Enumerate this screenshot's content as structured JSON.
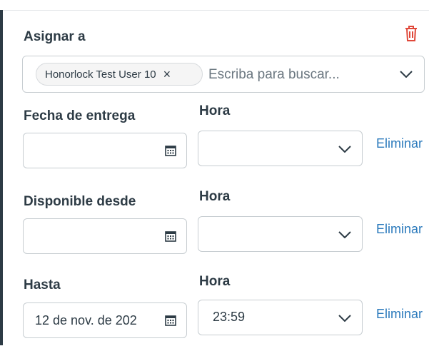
{
  "assign": {
    "label": "Asignar a",
    "chip_label": "Honorlock Test User 10",
    "chip_remove": "×",
    "search_placeholder": "Escriba para buscar..."
  },
  "rows": [
    {
      "date_label": "Fecha de entrega",
      "time_label": "Hora",
      "date_value": "",
      "time_value": "",
      "remove_label": "Eliminar"
    },
    {
      "date_label": "Disponible desde",
      "time_label": "Hora",
      "date_value": "",
      "time_value": "",
      "remove_label": "Eliminar"
    },
    {
      "date_label": "Hasta",
      "time_label": "Hora",
      "date_value": "12 de nov. de 202",
      "time_value": "23:59",
      "remove_label": "Eliminar"
    }
  ],
  "icons": {
    "delete": "trash-icon",
    "calendar": "calendar-icon",
    "dropdown": "chevron-down-icon"
  },
  "colors": {
    "link": "#2b7abc",
    "delete": "#e0483a",
    "text": "#2d3b45",
    "border": "#c7cdd1"
  }
}
